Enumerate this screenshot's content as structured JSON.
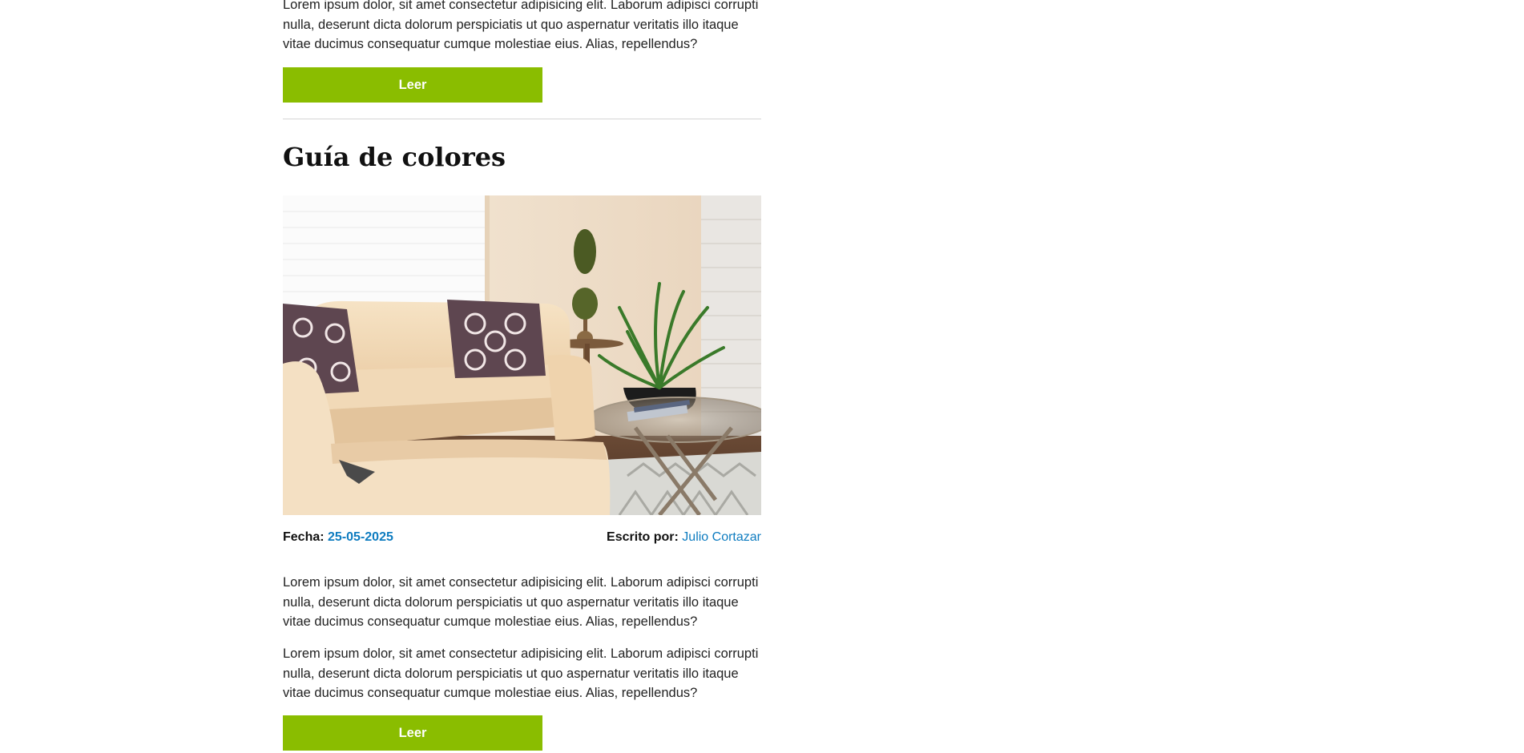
{
  "previous_post": {
    "excerpt": "Lorem ipsum dolor, sit amet consectetur adipisicing elit. Laborum adipisci corrupti nulla, deserunt dicta dolorum perspiciatis ut quo aspernatur veritatis illo itaque vitae ducimus consequatur cumque molestiae eius. Alias, repellendus?",
    "read_label": "Leer"
  },
  "post": {
    "title": "Guía de colores",
    "image_alt": "living-room-photo",
    "date_label": "Fecha:",
    "date_value": "25-05-2025",
    "author_label": "Escrito por:",
    "author_value": "Julio Cortazar",
    "paragraphs": [
      "Lorem ipsum dolor, sit amet consectetur adipisicing elit. Laborum adipisci corrupti nulla, deserunt dicta dolorum perspiciatis ut quo aspernatur veritatis illo itaque vitae ducimus consequatur cumque molestiae eius. Alias, repellendus?",
      "Lorem ipsum dolor, sit amet consectetur adipisicing elit. Laborum adipisci corrupti nulla, deserunt dicta dolorum perspiciatis ut quo aspernatur veritatis illo itaque vitae ducimus consequatur cumque molestiae eius. Alias, repellendus?"
    ],
    "read_label": "Leer"
  },
  "colors": {
    "accent_button": "#8ABD00",
    "link_blue": "#0E7CC0",
    "divider": "#D6D6D6"
  }
}
